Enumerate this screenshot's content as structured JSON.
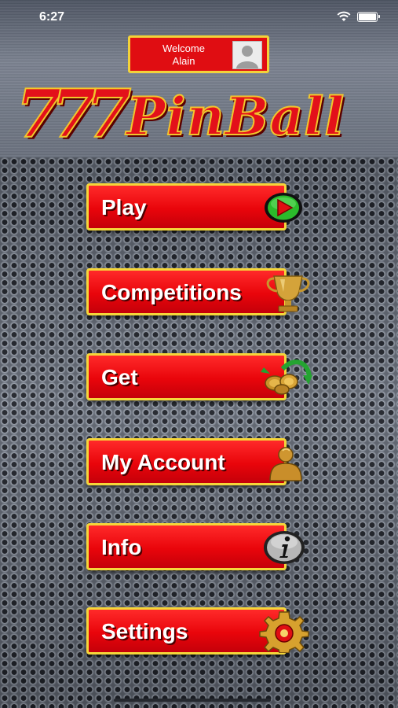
{
  "status_bar": {
    "time": "6:27"
  },
  "welcome": {
    "greeting": "Welcome",
    "user": "Alain"
  },
  "logo": {
    "sevens": "777",
    "name": "PinBall"
  },
  "menu": [
    {
      "id": "play",
      "label": "Play",
      "icon": "play-icon"
    },
    {
      "id": "competitions",
      "label": "Competitions",
      "icon": "trophy-icon"
    },
    {
      "id": "get",
      "label": "Get",
      "icon": "coins-icon"
    },
    {
      "id": "account",
      "label": "My Account",
      "icon": "user-icon"
    },
    {
      "id": "info",
      "label": "Info",
      "icon": "info-icon"
    },
    {
      "id": "settings",
      "label": "Settings",
      "icon": "gear-icon"
    }
  ],
  "colors": {
    "button_red": "#e9050b",
    "button_border": "#f5d63a",
    "logo_red": "#e3101a"
  }
}
